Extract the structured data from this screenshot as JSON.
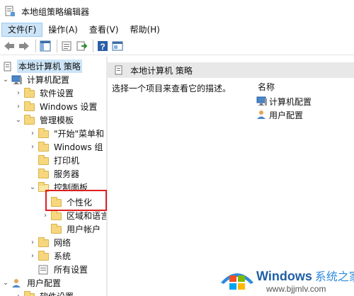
{
  "window": {
    "title": "本地组策略编辑器"
  },
  "menubar": [
    "文件(F)",
    "操作(A)",
    "查看(V)",
    "帮助(H)"
  ],
  "toolbar": [
    "back-icon",
    "forward-icon",
    "show-hide-tree-icon",
    "properties-icon",
    "export-list-icon",
    "help-icon",
    "extended-view-icon"
  ],
  "tree": [
    {
      "label": "本地计算机 策略",
      "level": 0,
      "arrow": "",
      "icon": "policy-doc-icon",
      "selected": true
    },
    {
      "label": "计算机配置",
      "level": 0,
      "arrow": "expanded",
      "icon": "computer-icon"
    },
    {
      "label": "软件设置",
      "level": 1,
      "arrow": "collapsed",
      "icon": "folder-icon"
    },
    {
      "label": "Windows 设置",
      "level": 1,
      "arrow": "collapsed",
      "icon": "folder-icon"
    },
    {
      "label": "管理模板",
      "level": 1,
      "arrow": "expanded",
      "icon": "folder-icon"
    },
    {
      "label": "\"开始\"菜单和",
      "level": 2,
      "arrow": "collapsed",
      "icon": "folder-icon"
    },
    {
      "label": "Windows 组",
      "level": 2,
      "arrow": "collapsed",
      "icon": "folder-icon"
    },
    {
      "label": "打印机",
      "level": 2,
      "arrow": "",
      "icon": "folder-icon"
    },
    {
      "label": "服务器",
      "level": 2,
      "arrow": "",
      "icon": "folder-icon"
    },
    {
      "label": "控制面板",
      "level": 2,
      "arrow": "expanded",
      "icon": "folder-open-icon"
    },
    {
      "label": "个性化",
      "level": 3,
      "arrow": "",
      "icon": "folder-icon"
    },
    {
      "label": "区域和语言",
      "level": 3,
      "arrow": "collapsed",
      "icon": "folder-icon"
    },
    {
      "label": "用户帐户",
      "level": 3,
      "arrow": "",
      "icon": "folder-icon"
    },
    {
      "label": "网络",
      "level": 2,
      "arrow": "collapsed",
      "icon": "folder-icon"
    },
    {
      "label": "系统",
      "level": 2,
      "arrow": "collapsed",
      "icon": "folder-icon"
    },
    {
      "label": "所有设置",
      "level": 2,
      "arrow": "",
      "icon": "settings-icon"
    },
    {
      "label": "用户配置",
      "level": 0,
      "arrow": "expanded",
      "icon": "user-icon"
    },
    {
      "label": "软件设置",
      "level": 1,
      "arrow": "collapsed",
      "icon": "folder-icon"
    }
  ],
  "right": {
    "header": "本地计算机 策略",
    "description": "选择一个项目来查看它的描述。",
    "column": "名称",
    "items": [
      {
        "label": "计算机配置",
        "icon": "computer-icon"
      },
      {
        "label": "用户配置",
        "icon": "user-icon"
      }
    ]
  },
  "watermark": {
    "brand": "Windows",
    "cn": "系统之家",
    "url": "www.bjjmlv.com"
  }
}
